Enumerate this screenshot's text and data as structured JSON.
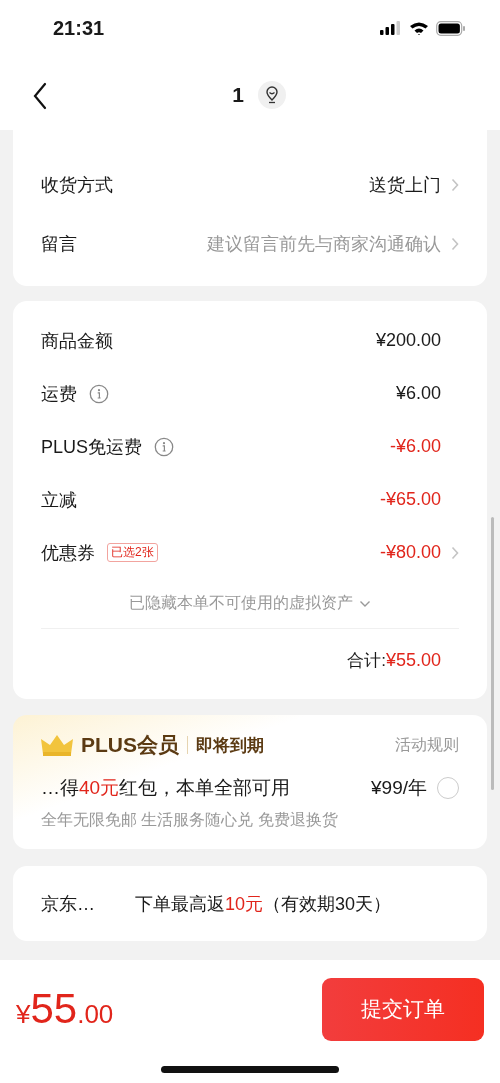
{
  "status_bar": {
    "time": "21:31"
  },
  "header": {
    "title": "1"
  },
  "delivery": {
    "rows": [
      {
        "label": "收货方式",
        "value": "送货上门",
        "kind": "value"
      },
      {
        "label": "留言",
        "value": "建议留言前先与商家沟通确认",
        "kind": "hint"
      }
    ]
  },
  "summary": {
    "rows": [
      {
        "label": "商品金额",
        "info": false,
        "value": "¥200.00",
        "negative": false,
        "chevron": false
      },
      {
        "label": "运费",
        "info": true,
        "value": "¥6.00",
        "negative": false,
        "chevron": false
      },
      {
        "label": "PLUS免运费",
        "info": true,
        "value": "-¥6.00",
        "negative": true,
        "chevron": false
      },
      {
        "label": "立减",
        "info": false,
        "value": "-¥65.00",
        "negative": true,
        "chevron": false
      },
      {
        "label": "优惠券",
        "info": false,
        "badge": "已选2张",
        "value": "-¥80.00",
        "negative": true,
        "chevron": true
      }
    ],
    "hidden_note": "已隐藏本单不可使用的虚拟资产",
    "total_label": "合计:",
    "total_value": "¥55.00"
  },
  "plus": {
    "brand": "PLUS会员",
    "status": "即将到期",
    "rules": "活动规则",
    "offer": [
      {
        "text": "…得",
        "highlight": false
      },
      {
        "text": "40元",
        "highlight": true
      },
      {
        "text": "红包，本单全部可用",
        "highlight": false
      }
    ],
    "price": "¥99/年",
    "selected": false,
    "benefits": "全年无限免邮 生活服务随心兑 免费退换货"
  },
  "rebate": {
    "label": "京东…",
    "text": [
      {
        "text": "下单最高返",
        "highlight": false
      },
      {
        "text": "10元",
        "highlight": true
      },
      {
        "text": "（有效期30天）",
        "highlight": false
      }
    ]
  },
  "footer": {
    "currency": "¥",
    "integer": "55",
    "decimals": ".00",
    "submit": "提交订单"
  }
}
